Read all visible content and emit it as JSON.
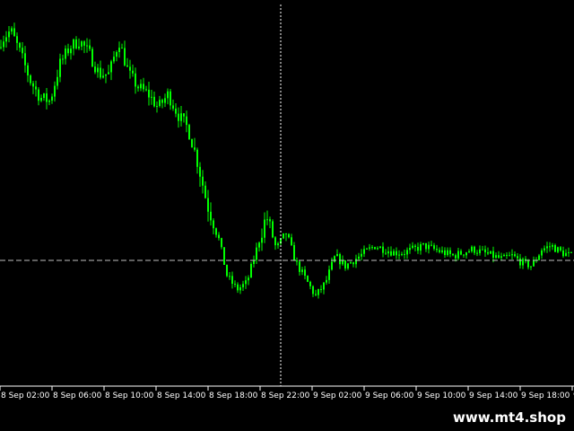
{
  "chart_data": {
    "type": "candlestick",
    "color": "#00ff00",
    "grid": false,
    "background": "#000000",
    "axis_color": "#ffffff",
    "x_tick_labels": [
      "8 Sep 02:00",
      "8 Sep 06:00",
      "8 Sep 10:00",
      "8 Sep 14:00",
      "8 Sep 18:00",
      "8 Sep 22:00",
      "9 Sep 02:00",
      "9 Sep 06:00",
      "9 Sep 10:00",
      "9 Sep 14:00",
      "9 Sep 18:00",
      "9 Se"
    ],
    "price_levels": [
      0.92,
      0.95,
      0.88,
      0.8,
      0.75,
      0.74,
      0.85,
      0.9,
      0.92,
      0.88,
      0.82,
      0.82,
      0.92,
      0.82,
      0.78,
      0.76,
      0.72,
      0.76,
      0.7,
      0.66,
      0.56,
      0.43,
      0.35,
      0.22,
      0.18,
      0.2,
      0.3,
      0.4,
      0.3,
      0.35,
      0.26,
      0.21,
      0.16,
      0.2,
      0.28,
      0.25,
      0.27,
      0.29,
      0.31,
      0.3,
      0.29,
      0.29,
      0.3,
      0.31,
      0.3,
      0.29,
      0.28,
      0.29,
      0.3,
      0.29,
      0.28,
      0.27,
      0.28,
      0.26,
      0.25,
      0.3,
      0.31,
      0.29,
      0.28
    ]
  },
  "watermark": "www.mt4.shop"
}
